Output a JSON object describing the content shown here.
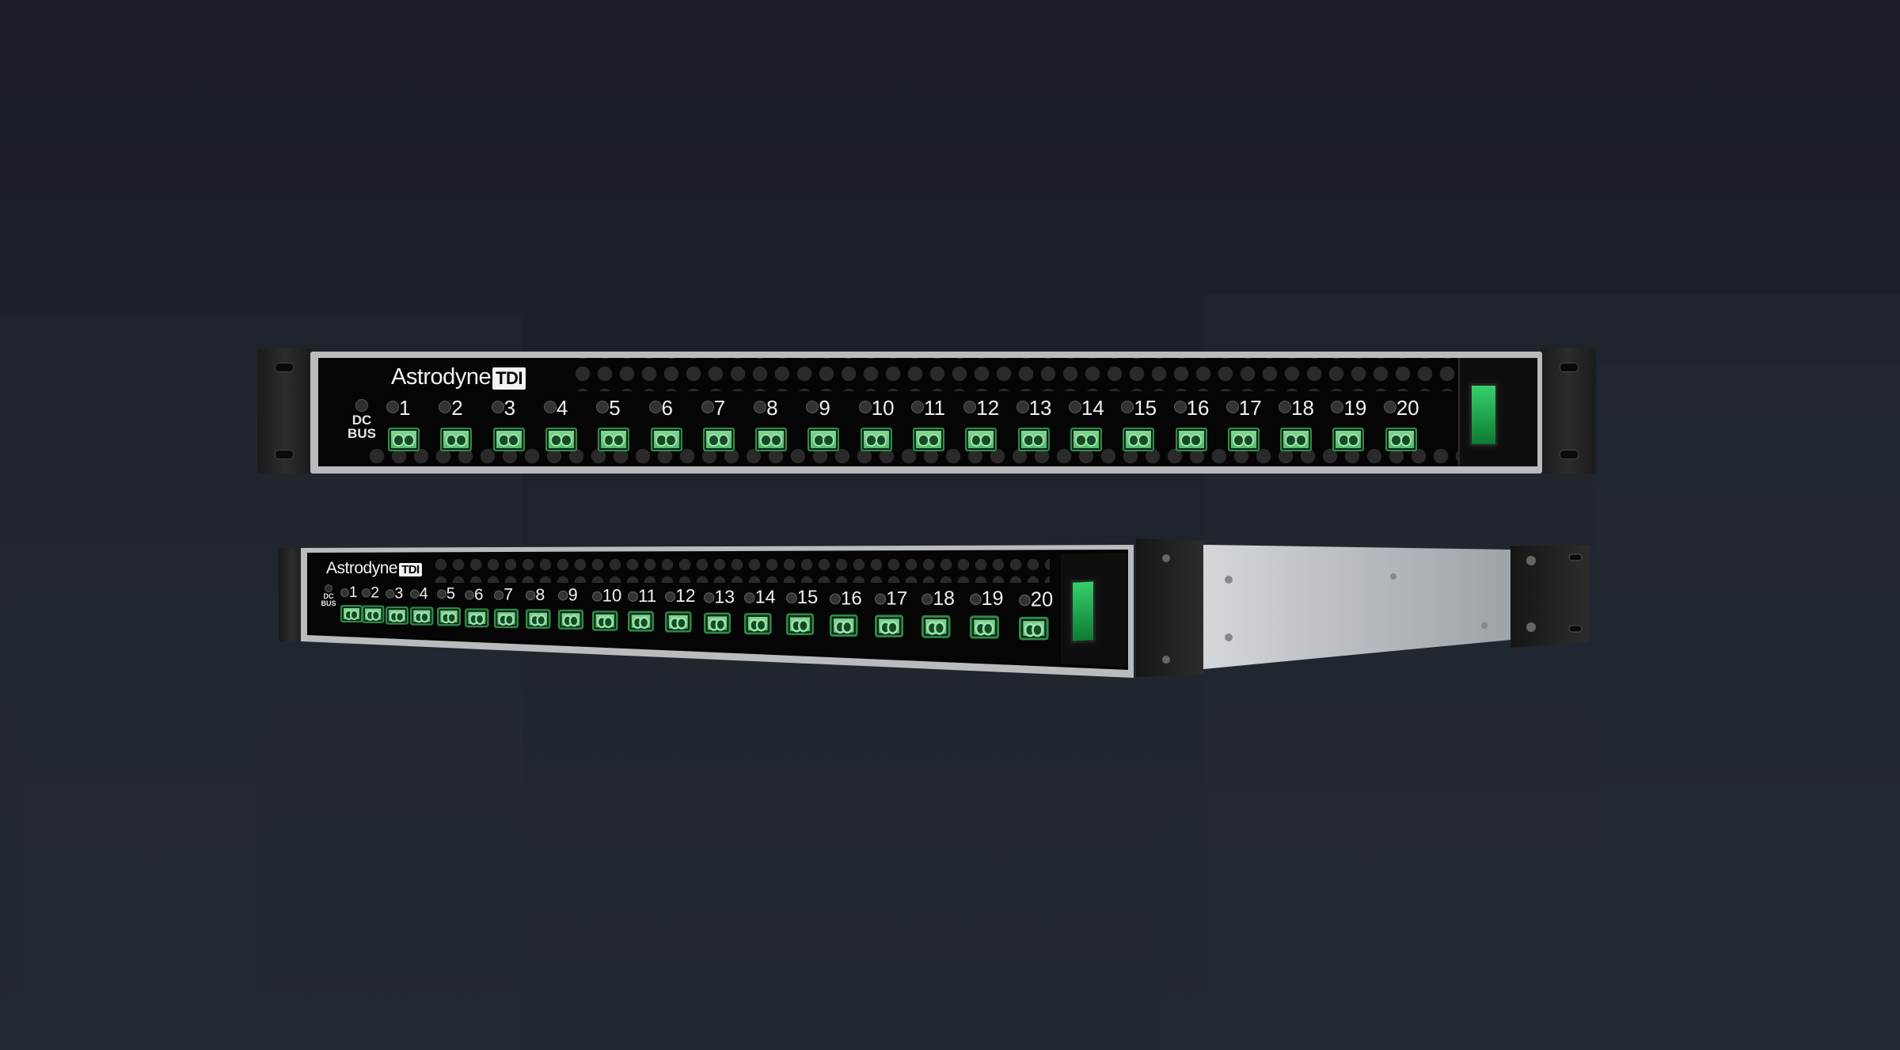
{
  "brand": {
    "name": "Astrodyne",
    "suffix": "TDI"
  },
  "front_unit": {
    "bus_label_line1": "DC",
    "bus_label_line2": "BUS",
    "channels": [
      "1",
      "2",
      "3",
      "4",
      "5",
      "6",
      "7",
      "8",
      "9",
      "10",
      "11",
      "12",
      "13",
      "14",
      "15",
      "16",
      "17",
      "18",
      "19",
      "20"
    ]
  },
  "angled_unit": {
    "bus_label_line1": "DC",
    "bus_label_line2": "BUS",
    "channels": [
      "1",
      "2",
      "3",
      "4",
      "5",
      "6",
      "7",
      "8",
      "9",
      "10",
      "11",
      "12",
      "13",
      "14",
      "15",
      "16",
      "17",
      "18",
      "19",
      "20"
    ]
  },
  "colors": {
    "background": "#1c2029",
    "panel": "#050505",
    "terminal_green": "#4fb56a",
    "switch_green": "#1fae4f",
    "chassis_silver": "#b8bcc0"
  }
}
